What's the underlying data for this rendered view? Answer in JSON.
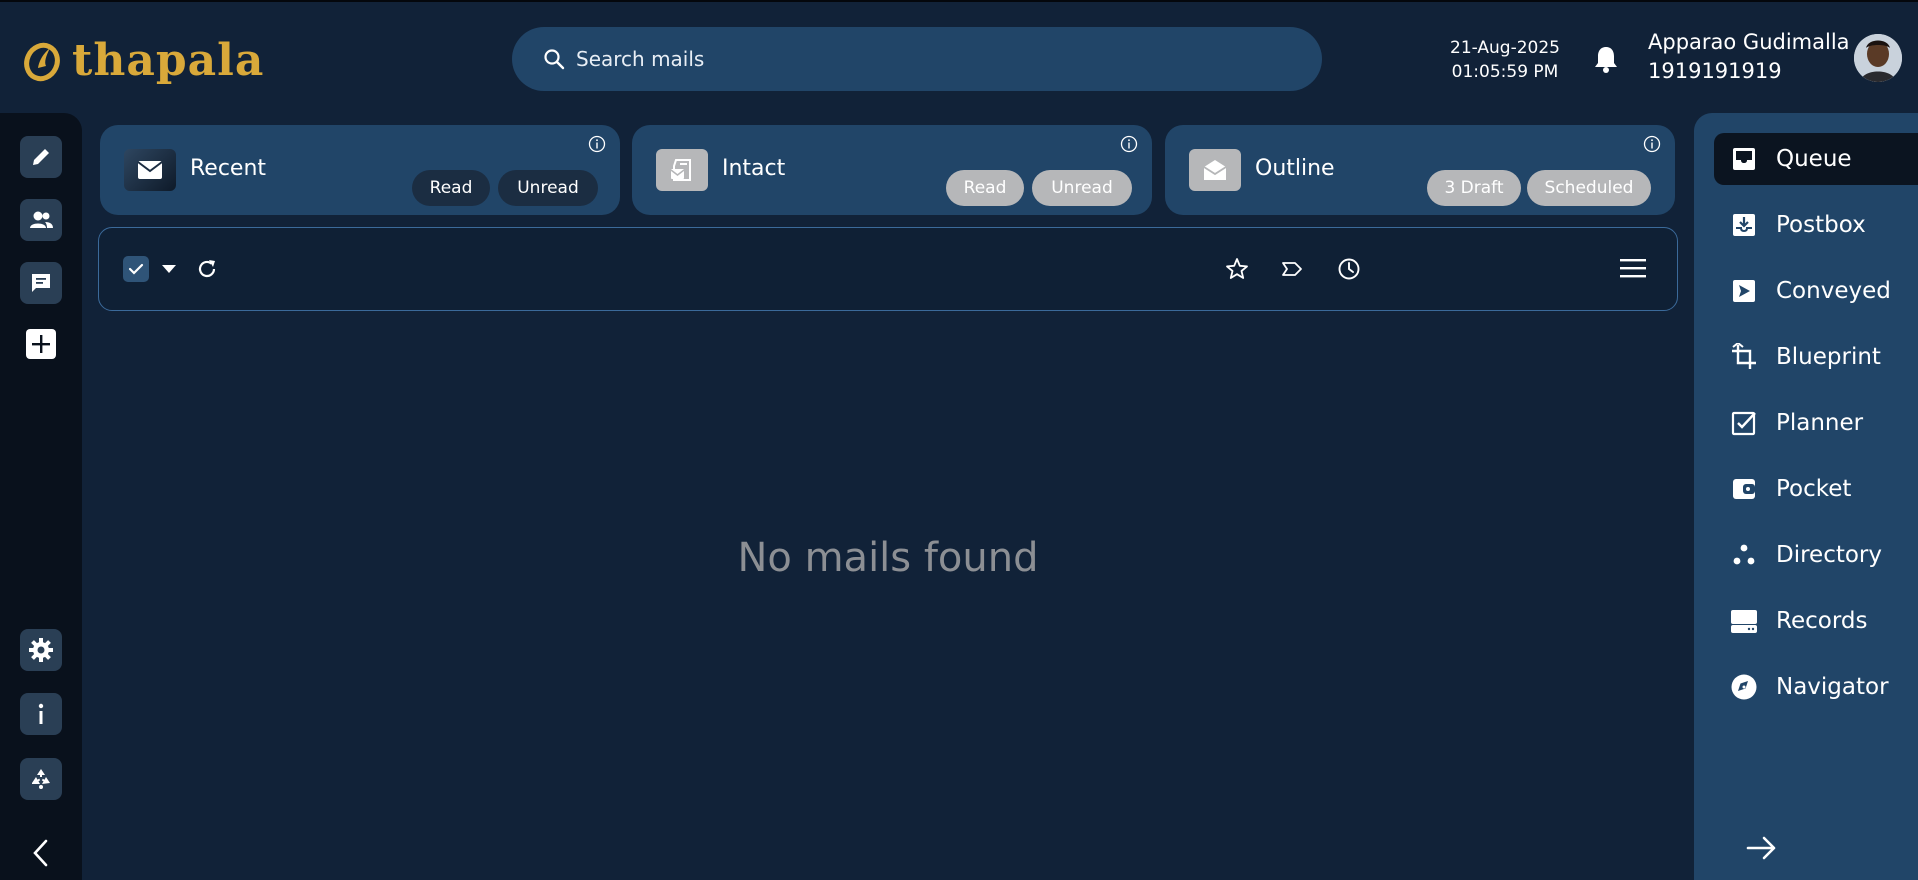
{
  "app": {
    "logo_text": "thapala"
  },
  "search": {
    "placeholder": "Search mails"
  },
  "header": {
    "date": "21-Aug-2025",
    "time": "01:05:59 PM"
  },
  "user": {
    "name": "Apparao Gudimalla",
    "phone": "1919191919"
  },
  "cards": [
    {
      "title": "Recent",
      "pills": [
        "Read",
        "Unread"
      ],
      "icon": "envelope-icon"
    },
    {
      "title": "Intact",
      "pills": [
        "Read",
        "Unread"
      ],
      "icon": "mailbox-icon"
    },
    {
      "title": "Outline",
      "pills": [
        "3 Draft",
        "Scheduled"
      ],
      "icon": "open-envelope-icon"
    }
  ],
  "main": {
    "empty_message": "No mails found"
  },
  "rightnav": {
    "items": [
      {
        "label": "Queue",
        "icon": "inbox-icon",
        "active": true
      },
      {
        "label": "Postbox",
        "icon": "download-box-icon"
      },
      {
        "label": "Conveyed",
        "icon": "send-icon"
      },
      {
        "label": "Blueprint",
        "icon": "crop-icon"
      },
      {
        "label": "Planner",
        "icon": "checkbox-icon"
      },
      {
        "label": "Pocket",
        "icon": "wallet-icon"
      },
      {
        "label": "Directory",
        "icon": "dots-icon"
      },
      {
        "label": "Records",
        "icon": "drive-icon"
      },
      {
        "label": "Navigator",
        "icon": "compass-icon"
      }
    ]
  },
  "colors": {
    "background": "#112238",
    "panel": "#214568",
    "accent_gold": "#d9a93a",
    "muted_text": "#8c8f94"
  }
}
